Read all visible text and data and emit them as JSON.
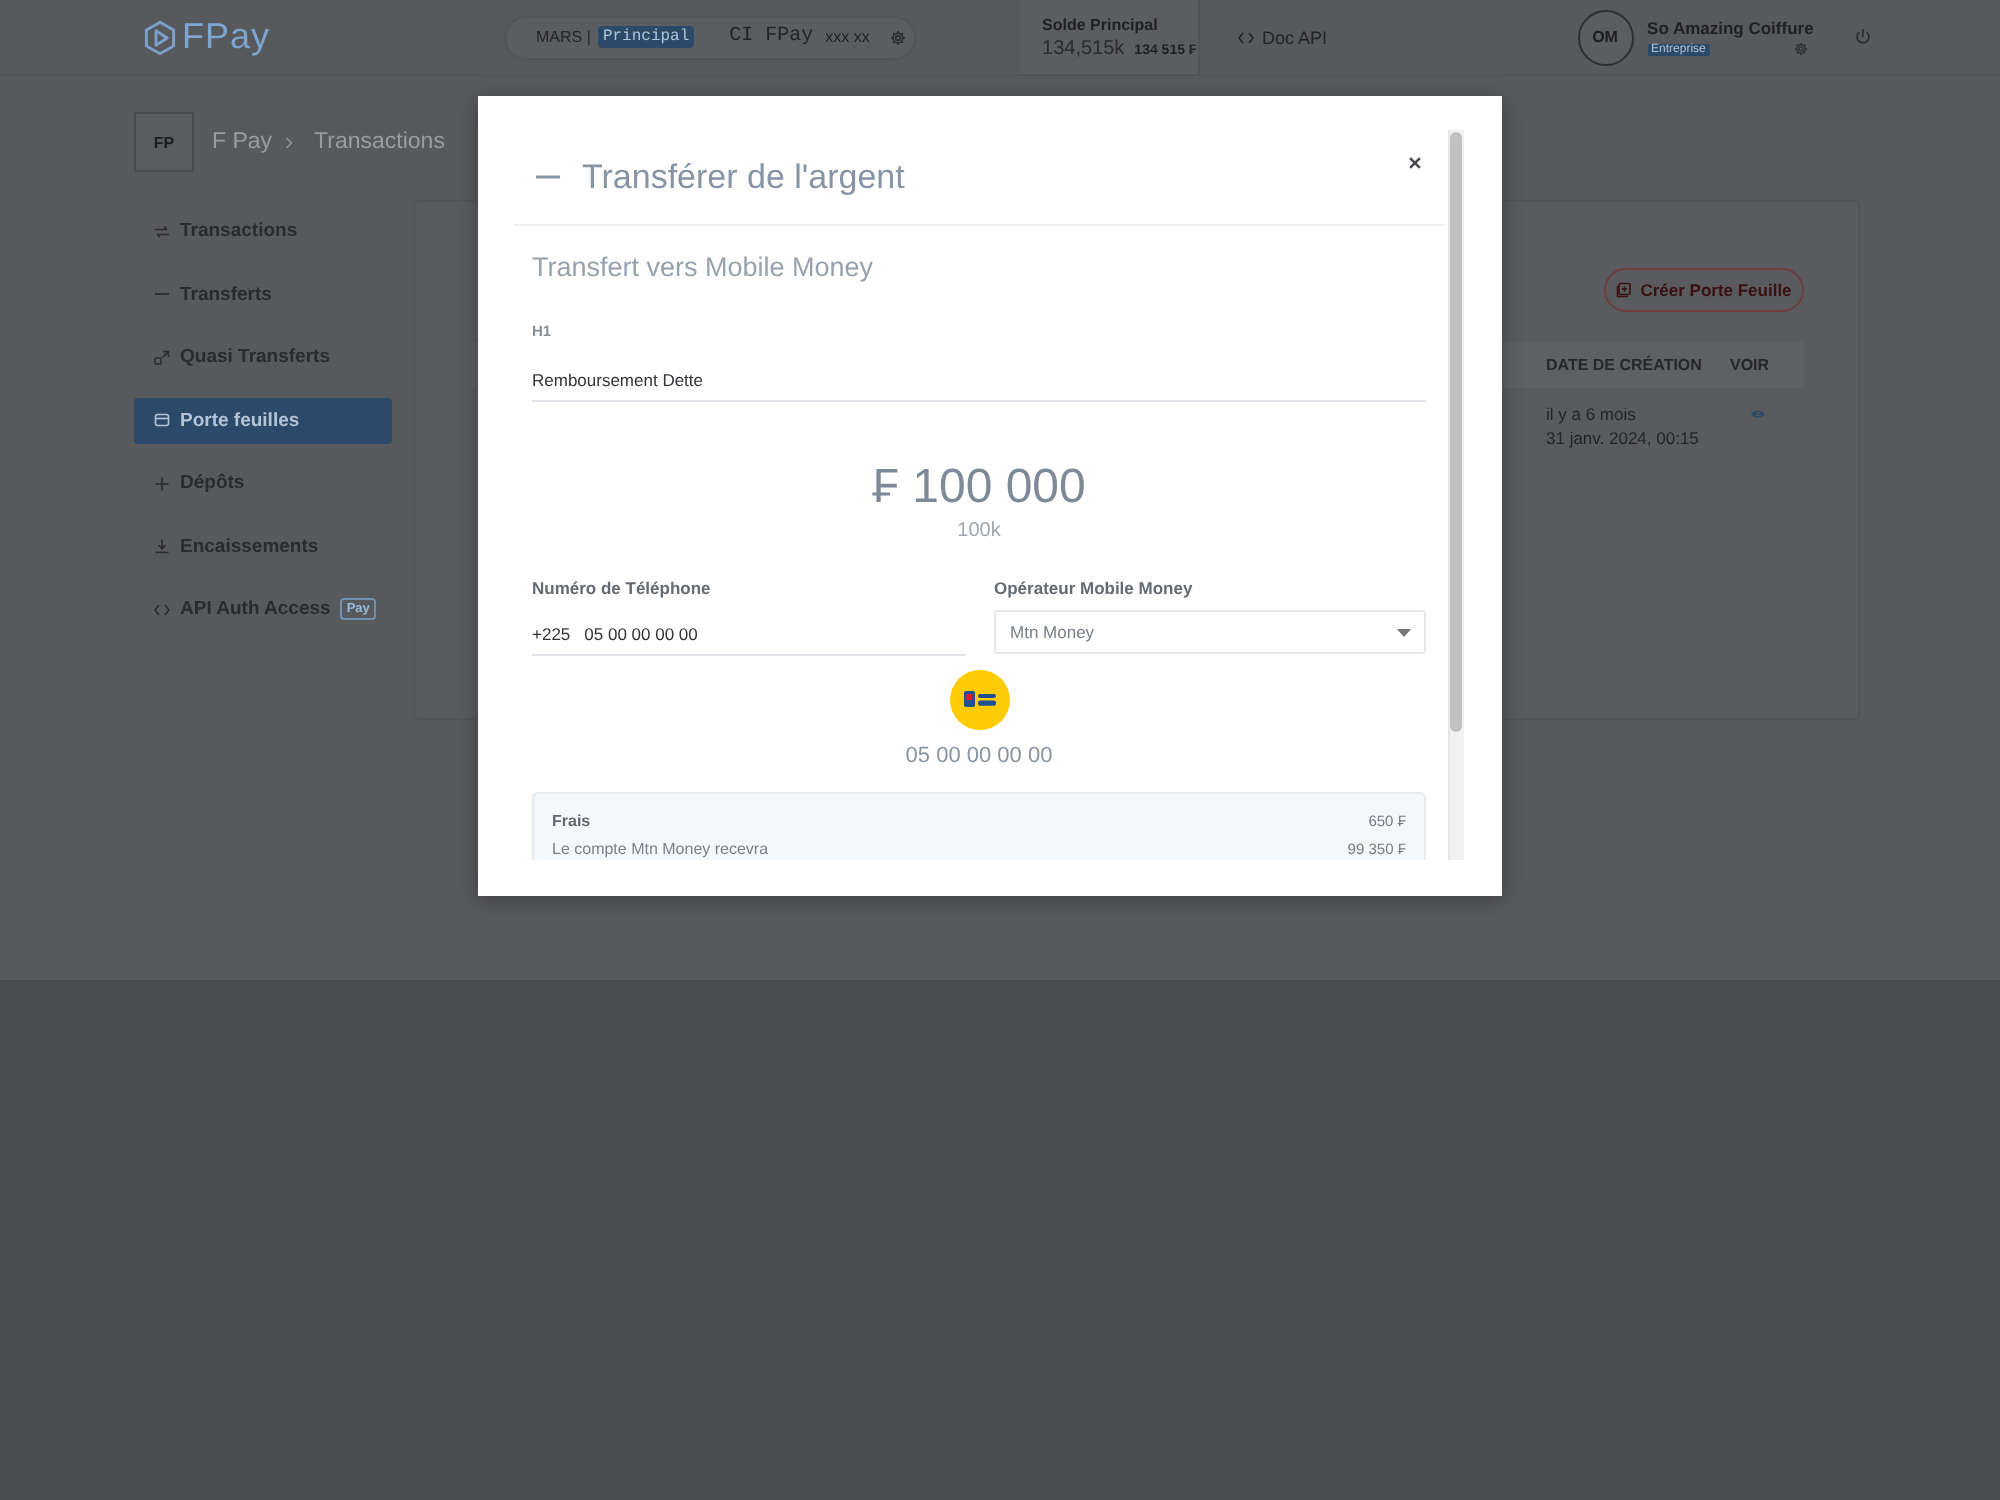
{
  "topbar": {
    "logo": "FPay",
    "account": {
      "name": "MARS |",
      "badge": "Principal",
      "app": "CI FPay",
      "number": "xxx xx"
    },
    "balance": {
      "label": "Solde Principal",
      "short": "134,515k",
      "full": "134 515 ₣"
    },
    "doc_link": "Doc API",
    "user": {
      "initials": "OM",
      "name": "So Amazing Coiffure",
      "badge": "Entreprise"
    }
  },
  "breadcrumb": {
    "badge": "FP",
    "items": [
      "F Pay",
      "Transactions"
    ]
  },
  "sidebar": {
    "items": [
      {
        "label": "Transactions",
        "selected": false
      },
      {
        "label": "Transferts",
        "selected": false
      },
      {
        "label": "Quasi Transferts",
        "selected": false
      },
      {
        "label": "Porte feuilles",
        "selected": true
      },
      {
        "label": "Dépôts",
        "selected": false
      },
      {
        "label": "Encaissements",
        "selected": false
      },
      {
        "label": "API Auth Access",
        "badge": "Pay",
        "selected": false
      }
    ]
  },
  "wallets": {
    "create_button": "Créer Porte Feuille",
    "table": {
      "columns": [
        "DATE DE CRÉATION",
        "VOIR"
      ],
      "rows": [
        {
          "relative_date": "il y a 6 mois",
          "date": "31 janv. 2024, 00:15"
        }
      ]
    }
  },
  "modal": {
    "title": "Transférer de l'argent",
    "subtitle": "Transfert vers Mobile Money",
    "reason": {
      "label": "H1",
      "value": "Remboursement Dette"
    },
    "amount": "₣ 100 000",
    "amount_short": "100k",
    "phone": {
      "label": "Numéro de Téléphone",
      "prefix": "+225",
      "value": "05 00 00 00 00"
    },
    "operator": {
      "label": "Opérateur Mobile Money",
      "value": "Mtn Money"
    },
    "recipient_number": "05 00 00 00 00",
    "summary": [
      {
        "kind": "fee",
        "label": "Frais",
        "value": "650 ₣"
      },
      {
        "kind": "net",
        "label": "Le compte Mtn Money recevra",
        "value": "99 350 ₣"
      }
    ]
  }
}
